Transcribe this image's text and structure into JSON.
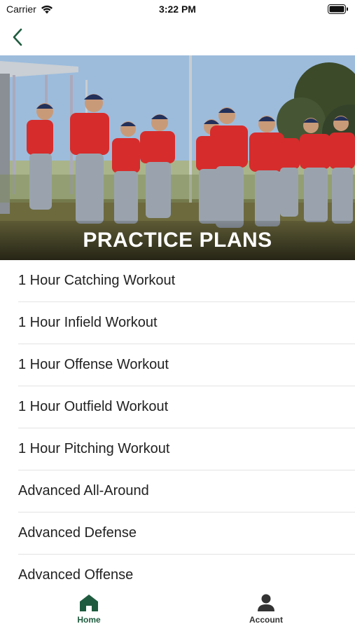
{
  "status_bar": {
    "carrier": "Carrier",
    "time": "3:22 PM"
  },
  "header": {
    "title": "PRACTICE PLANS"
  },
  "plans": [
    {
      "label": "1 Hour Catching Workout"
    },
    {
      "label": "1 Hour Infield Workout"
    },
    {
      "label": "1 Hour Offense Workout"
    },
    {
      "label": "1 Hour Outfield Workout"
    },
    {
      "label": "1 Hour Pitching Workout"
    },
    {
      "label": "Advanced All-Around"
    },
    {
      "label": "Advanced Defense"
    },
    {
      "label": "Advanced Offense"
    }
  ],
  "tabs": [
    {
      "label": "Home",
      "icon": "home-icon",
      "active": true
    },
    {
      "label": "Account",
      "icon": "account-icon",
      "active": false
    }
  ],
  "colors": {
    "accent": "#1f5c3f",
    "jersey": "#d62c2c",
    "pants": "#9aa3ad",
    "cap": "#22305a"
  }
}
